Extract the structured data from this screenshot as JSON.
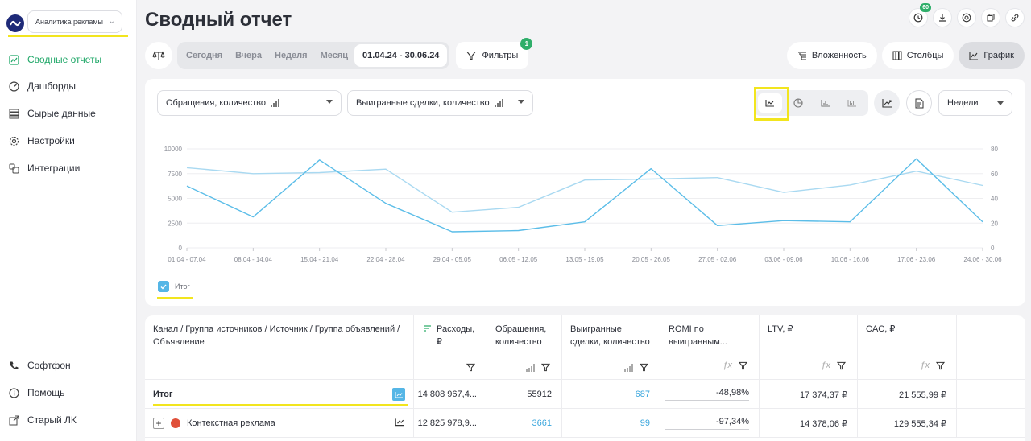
{
  "sidebar": {
    "account_select": "Аналитика рекламы",
    "items": [
      {
        "label": "Сводные отчеты",
        "icon": "report-icon",
        "active": true
      },
      {
        "label": "Дашборды",
        "icon": "dashboard-icon",
        "active": false
      },
      {
        "label": "Сырые данные",
        "icon": "raw-data-icon",
        "active": false
      },
      {
        "label": "Настройки",
        "icon": "gear-icon",
        "active": false
      },
      {
        "label": "Интеграции",
        "icon": "integrations-icon",
        "active": false
      }
    ],
    "bottom_items": [
      {
        "label": "Софтфон",
        "icon": "phone-icon"
      },
      {
        "label": "Помощь",
        "icon": "help-icon"
      },
      {
        "label": "Старый ЛК",
        "icon": "external-link-icon"
      }
    ]
  },
  "header": {
    "title": "Сводный отчет",
    "notification_count": "60"
  },
  "toolbar": {
    "periods": [
      "Сегодня",
      "Вчера",
      "Неделя",
      "Месяц"
    ],
    "date_range": "01.04.24 - 30.06.24",
    "filters_label": "Фильтры",
    "filters_count": "1",
    "nesting_label": "Вложенность",
    "columns_label": "Столбцы",
    "chart_label": "График"
  },
  "chart_controls": {
    "metric_left": "Обращения, количество",
    "metric_right": "Выигранные сделки, количество",
    "granularity": "Недели",
    "legend_label": "Итог"
  },
  "chart_data": {
    "type": "line",
    "x": [
      "01.04 - 07.04",
      "08.04 - 14.04",
      "15.04 - 21.04",
      "22.04 - 28.04",
      "29.04 - 05.05",
      "06.05 - 12.05",
      "13.05 - 19.05",
      "20.05 - 26.05",
      "27.05 - 02.06",
      "03.06 - 09.06",
      "10.06 - 16.06",
      "17.06 - 23.06",
      "24.06 - 30.06"
    ],
    "y_left_ticks": [
      "10000",
      "7500",
      "5000",
      "2500",
      "0"
    ],
    "y_right_ticks": [
      "80",
      "60",
      "40",
      "20",
      "0"
    ],
    "ylim_left": [
      0,
      10000
    ],
    "ylim_right": [
      0,
      80
    ],
    "series": [
      {
        "axis": "left",
        "color": "#a9d9f1",
        "values": [
          8100,
          7500,
          7600,
          7950,
          3600,
          4100,
          6850,
          6950,
          7100,
          5600,
          6350,
          7750,
          6300
        ]
      },
      {
        "axis": "right",
        "color": "#5bbde8",
        "values": [
          50,
          25,
          71,
          36,
          13,
          14,
          21,
          64,
          18,
          22,
          21,
          72,
          21
        ]
      }
    ],
    "grid": true
  },
  "table": {
    "headers": [
      "Канал / Группа источников / Источник / Группа объявлений / Объявление",
      "Расходы, ₽",
      "Обращения, количество",
      "Выигранные сделки, количество",
      "ROMI по выигранным...",
      "LTV, ₽",
      "CAC, ₽"
    ],
    "rows": [
      {
        "name": "Итог",
        "cells": [
          "14 808 967,4...",
          "55912",
          "687",
          "-48,98%",
          "17 374,37 ₽",
          "21 555,99 ₽"
        ]
      },
      {
        "name": "Контекстная реклама",
        "cells": [
          "12 825 978,9...",
          "3661",
          "99",
          "-97,34%",
          "14 378,06 ₽",
          "129 555,34 ₽"
        ]
      }
    ]
  }
}
